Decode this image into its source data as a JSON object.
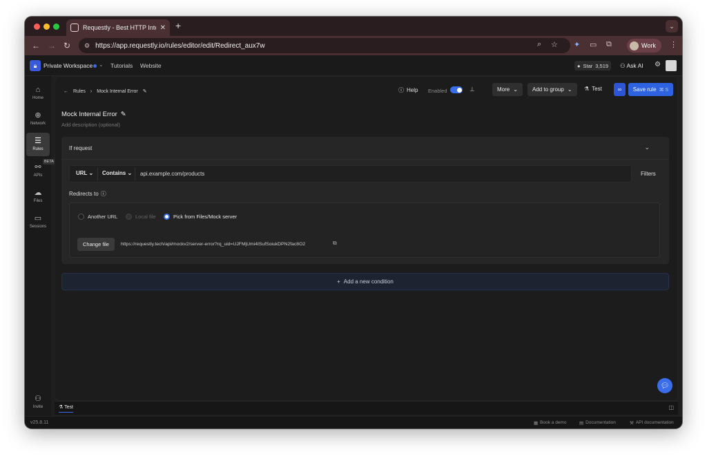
{
  "browser": {
    "tab_title": "Requestly - Best HTTP Interc",
    "url": "https://app.requestly.io/rules/editor/edit/Redirect_aux7w",
    "profile": "Work"
  },
  "header": {
    "workspace": "Private Workspace",
    "links": [
      "Tutorials",
      "Website"
    ],
    "github_star_label": "Star",
    "github_star_count": "3,519",
    "ask_ai": "Ask AI"
  },
  "sidebar": {
    "items": [
      {
        "label": "Home",
        "icon": "home-icon"
      },
      {
        "label": "Network",
        "icon": "globe-icon"
      },
      {
        "label": "Rules",
        "icon": "sliders-icon"
      },
      {
        "label": "APIs",
        "icon": "api-icon"
      },
      {
        "label": "Files",
        "icon": "cloud-icon"
      },
      {
        "label": "Sessions",
        "icon": "video-icon"
      }
    ],
    "beta": "BETA",
    "invite": "Invite",
    "version": "v25.8.11"
  },
  "toolbar": {
    "breadcrumb_root": "Rules",
    "breadcrumb_current": "Mock Internal Error",
    "help": "Help",
    "enabled_label": "Enabled",
    "enabled": true,
    "more": "More",
    "add_to_group": "Add to group",
    "test": "Test",
    "save": "Save rule",
    "save_shortcut": "⌘ S"
  },
  "rule": {
    "name": "Mock Internal Error",
    "description_placeholder": "Add description (optional)",
    "if_request": "If request",
    "match_field": "URL",
    "match_operator": "Contains",
    "match_value": "api.example.com/products",
    "filters": "Filters",
    "redirects_to": "Redirects to",
    "options": [
      "Another URL",
      "Local file",
      "Pick from Files/Mock server"
    ],
    "selected_option": "Pick from Files/Mock server",
    "change_file": "Change file",
    "file_url": "https://requestly.tech/api/mockv2/server-error?rq_uid=UJFMjUmi4ISufSoiukDPN2fac8O2",
    "add_condition": "Add a new condition"
  },
  "bottom": {
    "tab": "Test"
  },
  "footer": {
    "links": [
      "Book a demo",
      "Documentation",
      "API documentation"
    ]
  },
  "colors": {
    "accent": "#2d62e0",
    "tab_bar": "#2a1d1f",
    "address_bar": "#4a2f33",
    "background": "#1c1c1c"
  }
}
